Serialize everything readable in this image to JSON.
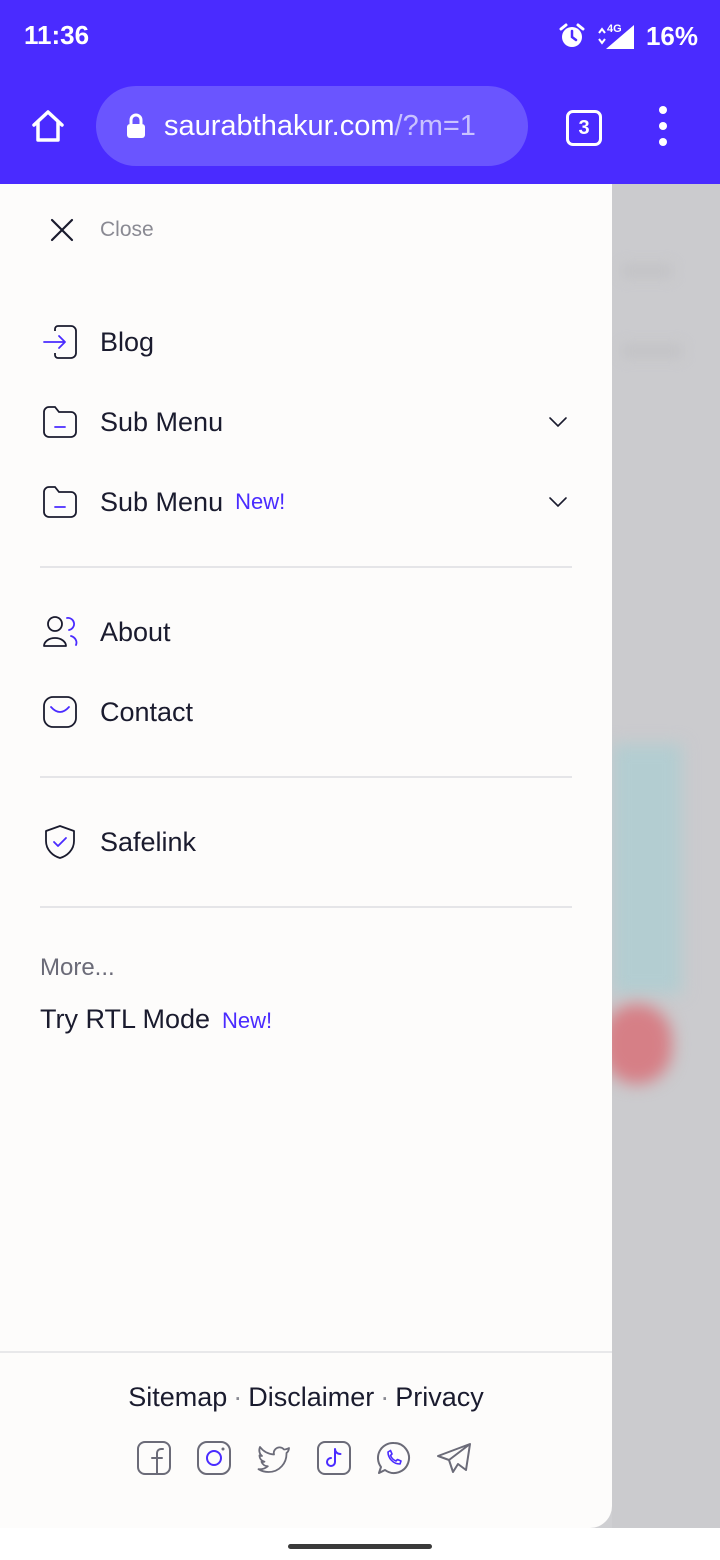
{
  "status_bar": {
    "time": "11:36",
    "network": "4G",
    "battery": "16%"
  },
  "browser": {
    "url_host": "saurabthakur.com",
    "url_path": "/?m=1",
    "tab_count": "3"
  },
  "drawer": {
    "close_label": "Close",
    "items": [
      {
        "label": "Blog",
        "icon": "login-arrow-icon"
      },
      {
        "label": "Sub Menu",
        "icon": "folder-icon",
        "expandable": true
      },
      {
        "label": "Sub Menu",
        "badge": "New!",
        "icon": "folder-icon",
        "expandable": true
      },
      {
        "label": "About",
        "icon": "users-icon"
      },
      {
        "label": "Contact",
        "icon": "mail-icon"
      },
      {
        "label": "Safelink",
        "icon": "shield-check-icon"
      }
    ],
    "more_label": "More...",
    "rtl_label": "Try RTL Mode",
    "rtl_badge": "New!"
  },
  "footer": {
    "links": [
      "Sitemap",
      "Disclaimer",
      "Privacy"
    ],
    "separator": "·",
    "socials": [
      "facebook-icon",
      "instagram-icon",
      "twitter-icon",
      "tiktok-icon",
      "whatsapp-icon",
      "telegram-icon"
    ]
  },
  "colors": {
    "accent": "#4a2bff",
    "text": "#1a1b2e",
    "muted": "#8a8a93",
    "drawer_bg": "#fdfcfb"
  }
}
